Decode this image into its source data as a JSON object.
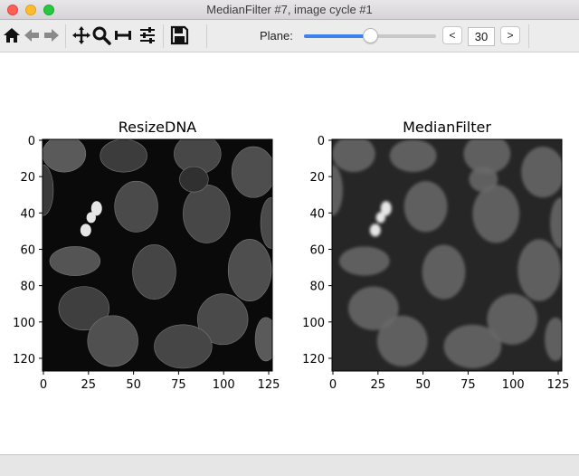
{
  "window": {
    "title": "MedianFilter #7, image cycle #1"
  },
  "toolbar": {
    "icons": [
      "home-icon",
      "back-arrow-icon",
      "forward-arrow-icon",
      "pan-icon",
      "zoom-icon",
      "subplots-icon",
      "configure-icon",
      "save-icon"
    ],
    "plane_label": "Plane:",
    "plane_value": "30",
    "plane_fraction": 0.5,
    "prev_label": "<",
    "next_label": ">"
  },
  "figure": {
    "panels": [
      {
        "title": "ResizeDNA",
        "xticks": [
          "0",
          "25",
          "50",
          "75",
          "100",
          "125"
        ],
        "yticks": [
          "0",
          "20",
          "40",
          "60",
          "80",
          "100",
          "120"
        ],
        "background": "#0a0a0a",
        "blur": false
      },
      {
        "title": "MedianFilter",
        "xticks": [
          "0",
          "25",
          "50",
          "75",
          "100",
          "125"
        ],
        "yticks": [
          "0",
          "20",
          "40",
          "60",
          "80",
          "100",
          "120"
        ],
        "background": "#262626",
        "blur": true
      }
    ]
  }
}
